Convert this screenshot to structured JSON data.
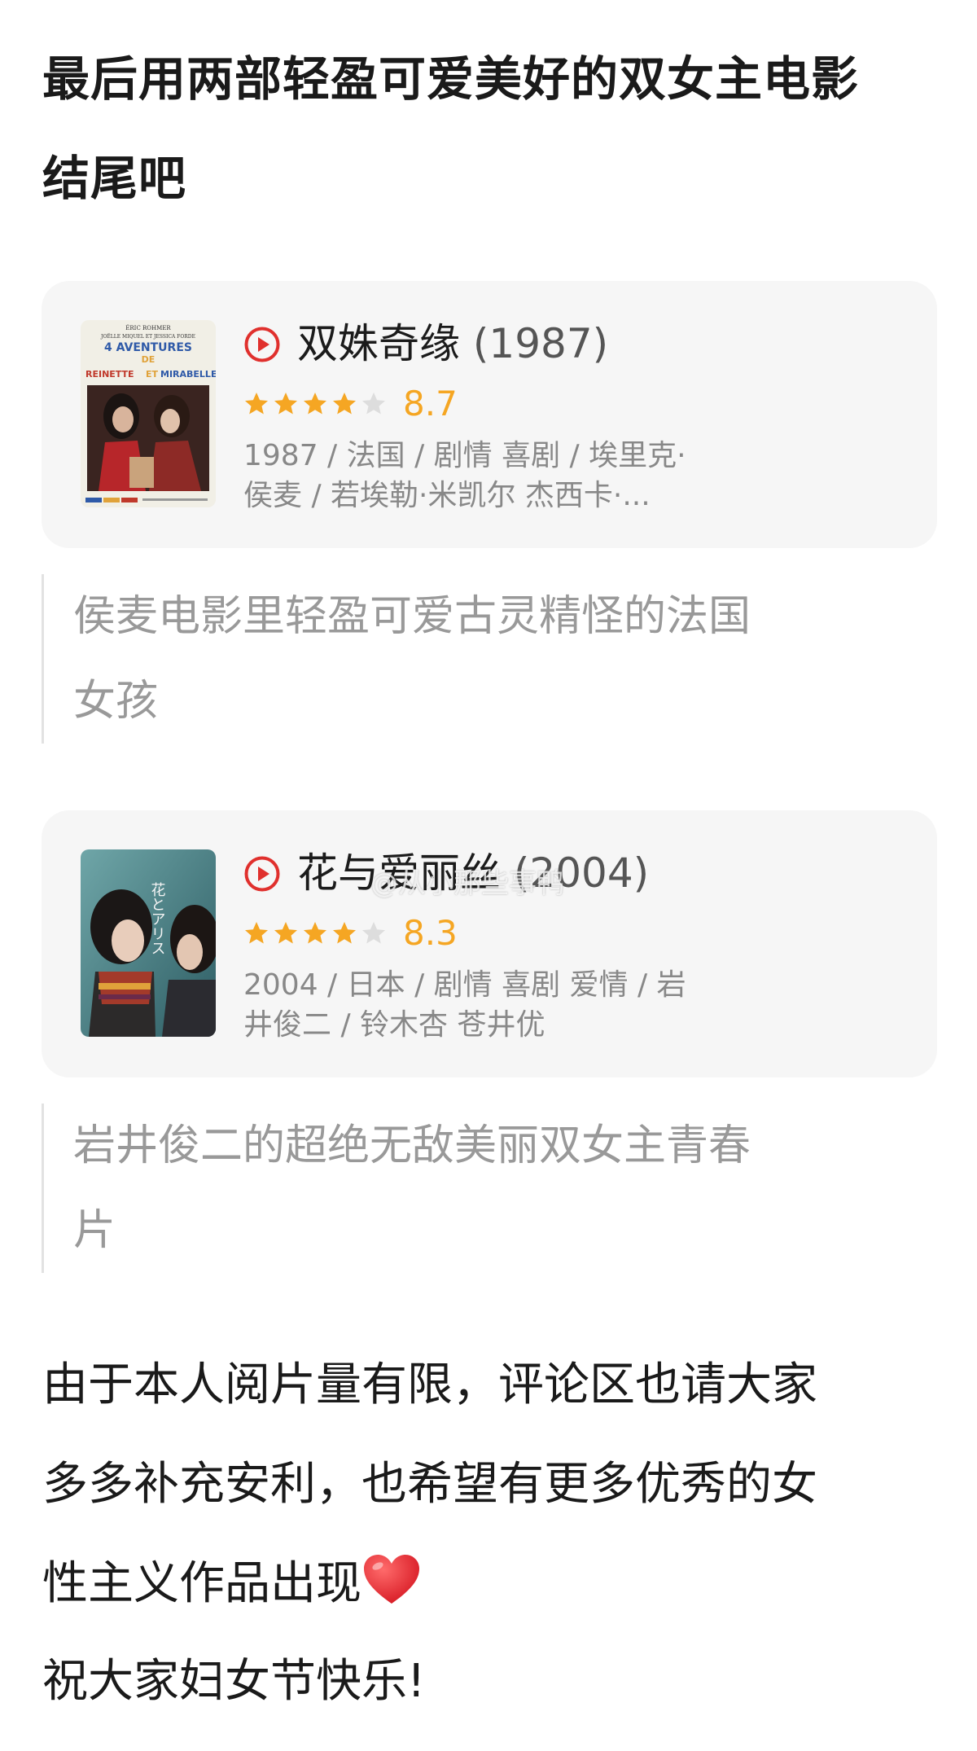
{
  "post": {
    "heading_lines": [
      "最后用两部轻盈可爱美好的双女主电影",
      "结尾吧"
    ],
    "closing_lines": [
      "由于本人阅片量有限，评论区也请大家",
      "多多补充安利，也希望有更多优秀的女",
      "性主义作品出现",
      "祝大家妇女节快乐!"
    ],
    "closing_emoji": "heart-icon"
  },
  "movies": [
    {
      "title": "双姝奇缘",
      "year": "(1987)",
      "rating": "8.7",
      "stars": 4,
      "meta_lines": [
        "1987 / 法国 / 剧情 喜剧 / 埃里克·",
        "侯麦 / 若埃勒·米凯尔 杰西卡·..."
      ],
      "poster_text": {
        "top": "ÉRIC ROHMER",
        "stars": "JOËLLE MIQUEL  ET  JESSICA FORDE",
        "headline": "4  AVENTURES",
        "de": "DE",
        "names_a": "REINETTE",
        "names_et": "ET",
        "names_b": "MIRABELLE"
      },
      "comment_lines": [
        "侯麦电影里轻盈可爱古灵精怪的法国",
        "女孩"
      ]
    },
    {
      "title": "花与爱丽丝",
      "year": "(2004)",
      "rating": "8.3",
      "stars": 4,
      "meta_lines": [
        "2004 / 日本 / 剧情 喜剧 爱情 / 岩",
        "井俊二 / 铃木杏 苍井优"
      ],
      "poster_text": {
        "vertical_title": "花とアリス"
      },
      "comment_lines": [
        "岩井俊二的超绝无敌美丽双女主青春",
        "片"
      ]
    }
  ],
  "watermark": "@从小那些事鸭",
  "colors": {
    "card_bg": "#f6f6f6",
    "play_icon": "#e0302d",
    "star_filled": "#f5a623",
    "star_empty": "#dddddd",
    "score": "#f5a623",
    "meta_text": "#888888",
    "quote_text": "#999999",
    "heart": "#e0232d"
  }
}
